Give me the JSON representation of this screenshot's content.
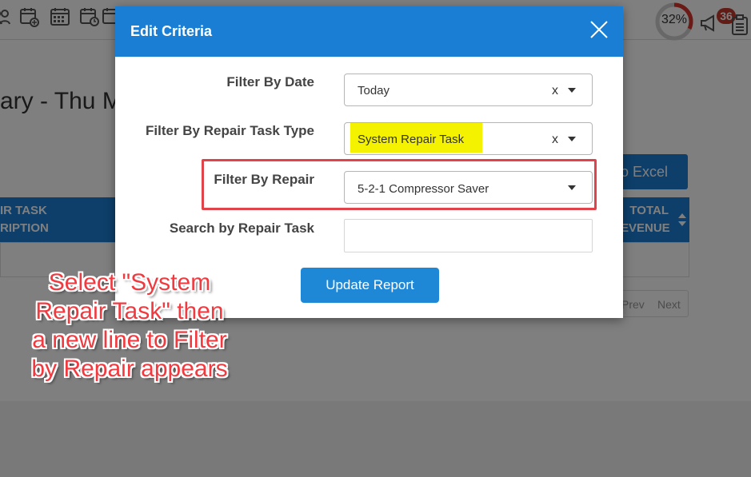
{
  "background": {
    "page_title": "ary - Thu M",
    "progress_percent_label": "32%",
    "progress_value": 0.32,
    "notification_count": "36",
    "export_button_label": "o Excel",
    "table_headers": {
      "left_line1": "IR TASK",
      "left_line2": "RIPTION",
      "right_line1": "TOTAL",
      "right_line2": "EVENUE"
    },
    "pager": {
      "prev": "Prev",
      "next": "Next"
    }
  },
  "modal": {
    "title": "Edit Criteria",
    "close_icon": "close-icon",
    "fields": {
      "filter_by_date": {
        "label": "Filter By Date",
        "value": "Today",
        "clear": "x"
      },
      "filter_by_repair_task_type": {
        "label": "Filter By Repair Task Type",
        "value": "System Repair Task",
        "clear": "x"
      },
      "filter_by_repair": {
        "label": "Filter By Repair",
        "value": "5-2-1 Compressor Saver"
      },
      "search_by_repair_task": {
        "label": "Search by Repair Task",
        "value": ""
      }
    },
    "update_button_label": "Update Report"
  },
  "annotation": {
    "line1": "Select \"System",
    "line2": "Repair Task\" then",
    "line3": "a new line to Filter",
    "line4": "by Repair appears"
  },
  "colors": {
    "header_blue": "#1a7fd4",
    "highlight_yellow": "#f5f200",
    "annotation_red": "#f03a3f",
    "badge_red": "#c0392b"
  }
}
